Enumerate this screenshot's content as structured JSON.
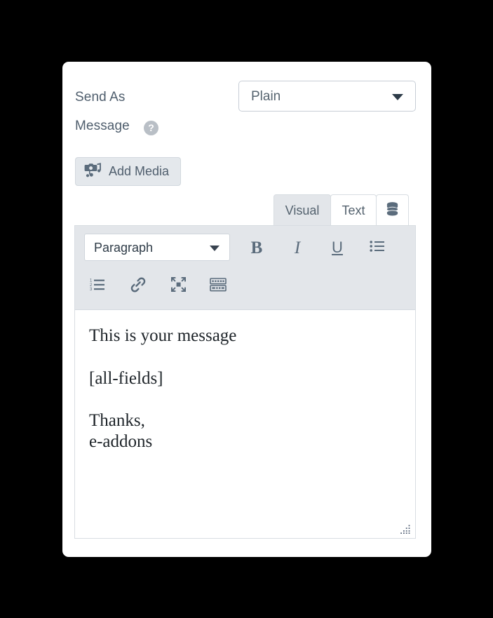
{
  "form": {
    "send_as": {
      "label": "Send As",
      "value": "Plain",
      "caret_icon": "chevron-down-icon"
    },
    "message": {
      "label": "Message",
      "help_icon_glyph": "?",
      "help_icon_name": "help-circle-icon"
    },
    "add_media": {
      "label": "Add Media",
      "icon_name": "camera-music-icon"
    }
  },
  "editor": {
    "tabs": [
      {
        "label": "Visual",
        "active": true,
        "name": "tab-visual"
      },
      {
        "label": "Text",
        "active": false,
        "name": "tab-text"
      },
      {
        "label": "",
        "active": false,
        "name": "tab-database",
        "icon": "database-icon"
      }
    ],
    "toolbar": {
      "format_select": {
        "value": "Paragraph",
        "caret_icon": "chevron-down-icon"
      },
      "row1": [
        {
          "name": "bold-button",
          "glyph": "B",
          "title": "Bold"
        },
        {
          "name": "italic-button",
          "glyph": "I",
          "title": "Italic"
        },
        {
          "name": "underline-button",
          "glyph": "U",
          "title": "Underline"
        },
        {
          "name": "bulleted-list-button",
          "glyph": "list",
          "title": "Bulleted list"
        }
      ],
      "row2": [
        {
          "name": "numbered-list-button",
          "glyph": "ordered-list",
          "title": "Numbered list"
        },
        {
          "name": "link-button",
          "glyph": "link",
          "title": "Insert/edit link"
        },
        {
          "name": "fullscreen-button",
          "glyph": "fullscreen",
          "title": "Distraction-free writing mode"
        },
        {
          "name": "keyboard-shortcuts-button",
          "glyph": "keyboard",
          "title": "Keyboard shortcuts"
        }
      ]
    },
    "content": {
      "line1": "This is your message",
      "line2": "[all-fields]",
      "line3": "Thanks,",
      "line4": "e-addons"
    },
    "statusbar": {
      "resize_handle_name": "resize-grip"
    }
  },
  "colors": {
    "page_background": "#000000",
    "card_background": "#ffffff",
    "label_text": "#4f5e6d",
    "toolbar_background": "#e3e6ea",
    "active_tab_background": "#e3e6ea",
    "border": "#d8dde2",
    "button_background": "#e4e8ec",
    "content_text": "#1d2328",
    "help_icon_background": "#b9bfc6"
  }
}
